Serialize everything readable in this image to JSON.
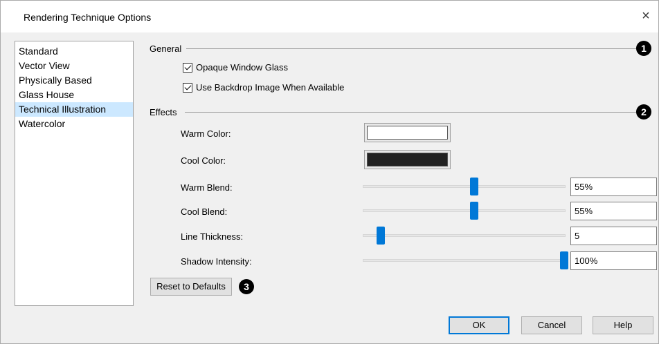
{
  "window": {
    "title": "Rendering Technique Options",
    "close_glyph": "×"
  },
  "techniques": {
    "items": [
      "Standard",
      "Vector View",
      "Physically Based",
      "Glass House",
      "Technical Illustration",
      "Watercolor"
    ],
    "selected": "Technical Illustration"
  },
  "general": {
    "label": "General",
    "callout": "1",
    "opaque_glass": {
      "label": "Opaque Window Glass",
      "checked": true
    },
    "backdrop": {
      "label": "Use Backdrop Image When Available",
      "checked": true
    }
  },
  "effects": {
    "label": "Effects",
    "callout": "2",
    "warm_color": {
      "label": "Warm Color:",
      "color": "#ffffff"
    },
    "cool_color": {
      "label": "Cool Color:",
      "color": "#222222"
    },
    "warm_blend": {
      "label": "Warm Blend:",
      "value": "55%",
      "fraction": 0.55
    },
    "cool_blend": {
      "label": "Cool Blend:",
      "value": "55%",
      "fraction": 0.55
    },
    "line_thickness": {
      "label": "Line Thickness:",
      "value": "5",
      "fraction": 0.09
    },
    "shadow_intensity": {
      "label": "Shadow Intensity:",
      "value": "100%",
      "fraction": 1.0
    }
  },
  "reset": {
    "label": "Reset to Defaults",
    "callout": "3"
  },
  "footer": {
    "ok": "OK",
    "cancel": "Cancel",
    "help": "Help"
  },
  "colors": {
    "accent": "#0078d7",
    "selection": "#cce8ff"
  }
}
